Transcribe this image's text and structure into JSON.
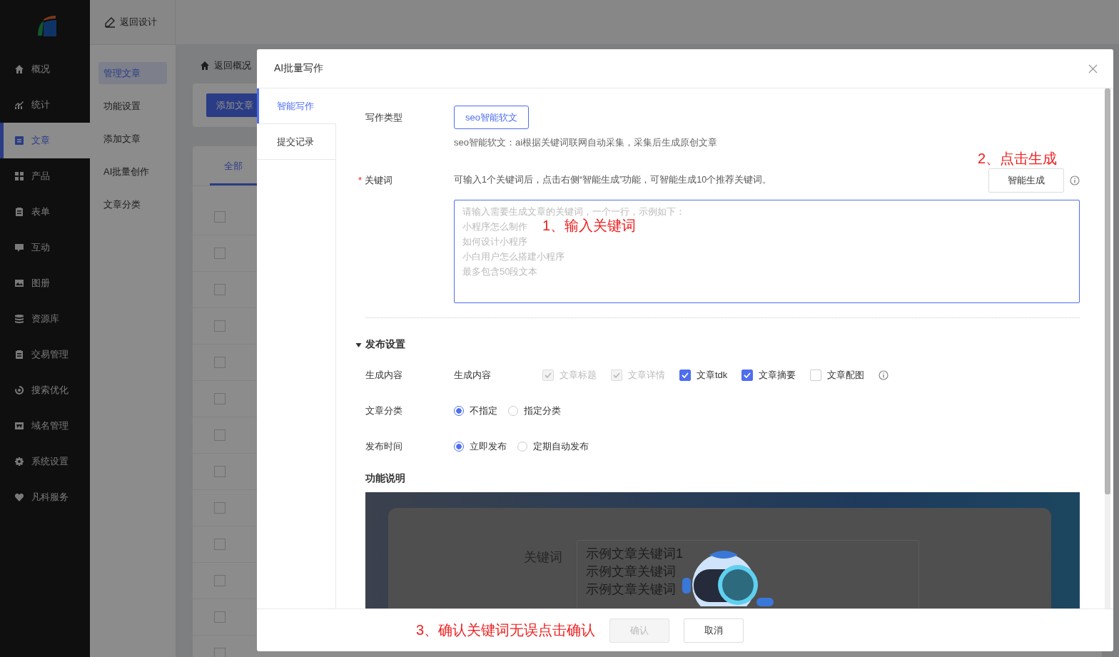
{
  "sidebar": {
    "items": [
      {
        "label": "概况",
        "selected": false
      },
      {
        "label": "统计",
        "selected": false
      },
      {
        "label": "文章",
        "selected": true
      },
      {
        "label": "产品",
        "selected": false
      },
      {
        "label": "表单",
        "selected": false
      },
      {
        "label": "互动",
        "selected": false
      },
      {
        "label": "图册",
        "selected": false
      },
      {
        "label": "资源库",
        "selected": false
      },
      {
        "label": "交易管理",
        "selected": false
      },
      {
        "label": "搜索优化",
        "selected": false
      },
      {
        "label": "域名管理",
        "selected": false
      },
      {
        "label": "系统设置",
        "selected": false
      },
      {
        "label": "凡科服务",
        "selected": false
      }
    ]
  },
  "topbar": {
    "back_label": "返回设计"
  },
  "subnav": {
    "items": [
      {
        "label": "管理文章",
        "selected": true
      },
      {
        "label": "功能设置",
        "selected": false
      },
      {
        "label": "添加文章",
        "selected": false
      },
      {
        "label": "AI批量创作",
        "selected": false
      },
      {
        "label": "文章分类",
        "selected": false
      }
    ]
  },
  "main": {
    "breadcrumb": "返回概况",
    "add_button": "添加文章",
    "tabs": [
      {
        "label": "全部",
        "selected": true
      }
    ],
    "rows": [
      {
        "checked": false
      },
      {
        "checked": false
      },
      {
        "checked": false
      },
      {
        "checked": false
      },
      {
        "checked": false
      },
      {
        "checked": false
      },
      {
        "checked": false
      },
      {
        "checked": false
      },
      {
        "checked": false
      },
      {
        "checked": false
      },
      {
        "checked": false
      },
      {
        "checked": false
      },
      {
        "checked": false
      }
    ]
  },
  "modal": {
    "title": "AI批量写作",
    "side_tabs": [
      {
        "label": "智能写作",
        "selected": true
      },
      {
        "label": "提交记录",
        "selected": false
      }
    ],
    "writing_type": {
      "label": "写作类型",
      "options": [
        {
          "label": "seo智能软文",
          "selected": true
        }
      ],
      "description": "seo智能软文：ai根据关键词联网自动采集，采集后生成原创文章"
    },
    "keywords": {
      "required_mark": "*",
      "label": "关键词",
      "hint": "可输入1个关键词后，点击右侧“智能生成”功能，可智能生成10个推荐关键词。",
      "generate_button": "智能生成",
      "button_annotation": "2、点击生成",
      "placeholder": [
        "请输入需要生成文章的关键词，一个一行，示例如下：",
        "小程序怎么制作",
        "如何设计小程序",
        "小白用户怎么搭建小程序",
        "最多包含50段文本"
      ],
      "input_annotation": "1、输入关键词"
    },
    "publish": {
      "title": "发布设置",
      "expanded": true,
      "content": {
        "label": "生成内容",
        "lead": "生成内容",
        "options": [
          {
            "label": "文章标题",
            "checked": true,
            "disabled": true
          },
          {
            "label": "文章详情",
            "checked": true,
            "disabled": true
          },
          {
            "label": "文章tdk",
            "checked": true,
            "disabled": false
          },
          {
            "label": "文章摘要",
            "checked": true,
            "disabled": false
          },
          {
            "label": "文章配图",
            "checked": false,
            "disabled": false
          }
        ]
      },
      "category": {
        "label": "文章分类",
        "options": [
          {
            "label": "不指定",
            "selected": true
          },
          {
            "label": "指定分类",
            "selected": false
          }
        ]
      },
      "time": {
        "label": "发布时间",
        "options": [
          {
            "label": "立即发布",
            "selected": true
          },
          {
            "label": "定期自动发布",
            "selected": false
          }
        ]
      }
    },
    "feature_note": {
      "title": "功能说明",
      "screenshot": {
        "label": "关键词",
        "lines": [
          "示例文章关键词1",
          "示例文章关键词",
          "示例文章关键词"
        ]
      }
    },
    "footer": {
      "annotation": "3、确认关键词无误点击确认",
      "confirm": {
        "label": "确认",
        "disabled": true
      },
      "cancel": "取消"
    }
  }
}
